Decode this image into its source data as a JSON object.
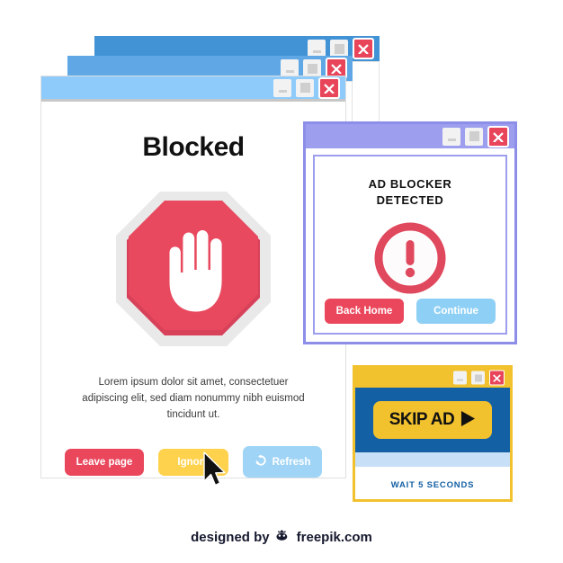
{
  "windows": {
    "back_windows": [
      {
        "id": "back-window-1",
        "titlebar_color": "#4292d6"
      },
      {
        "id": "back-window-2",
        "titlebar_color": "#5fa8e5"
      }
    ],
    "main": {
      "titlebar_color": "#8ecbfb",
      "title": "Blocked",
      "icon": "stop-sign-hand-icon",
      "body_text": "Lorem ipsum dolor sit amet, consectetuer adipiscing elit, sed diam nonummy nibh euismod tincidunt ut.",
      "buttons": {
        "leave": "Leave page",
        "ignore": "Ignore",
        "refresh": "Refresh"
      },
      "colors": {
        "leave": "#ea475c",
        "ignore": "#ffd24d",
        "refresh": "#9fd4f6",
        "sign": "#e8495e"
      }
    },
    "adblock": {
      "titlebar_color": "#9d9eee",
      "heading_line1": "AD BLOCKER",
      "heading_line2": "DETECTED",
      "icon": "exclamation-circle-icon",
      "buttons": {
        "back_home": "Back Home",
        "continue": "Continue"
      },
      "colors": {
        "back_home": "#ea475c",
        "continue": "#8ed0f5",
        "icon": "#e0485e"
      }
    },
    "skipad": {
      "titlebar_color": "#f2c12e",
      "button_label": "SKIP AD",
      "button_icon": "play-triangle-icon",
      "wait_text": "WAIT 5 SECONDS",
      "colors": {
        "panel": "#1360a4",
        "button": "#f2c12e",
        "strip": "#c8e0f7",
        "wait_text": "#1360a4"
      }
    }
  },
  "window_controls": {
    "minimize": "minimize-icon",
    "maximize": "maximize-icon",
    "close": "close-icon"
  },
  "cursor": {
    "icon": "mouse-pointer-icon"
  },
  "footer": {
    "prefix": "designed by",
    "logo": "freepik-logo-icon",
    "brand": "freepik.com"
  }
}
